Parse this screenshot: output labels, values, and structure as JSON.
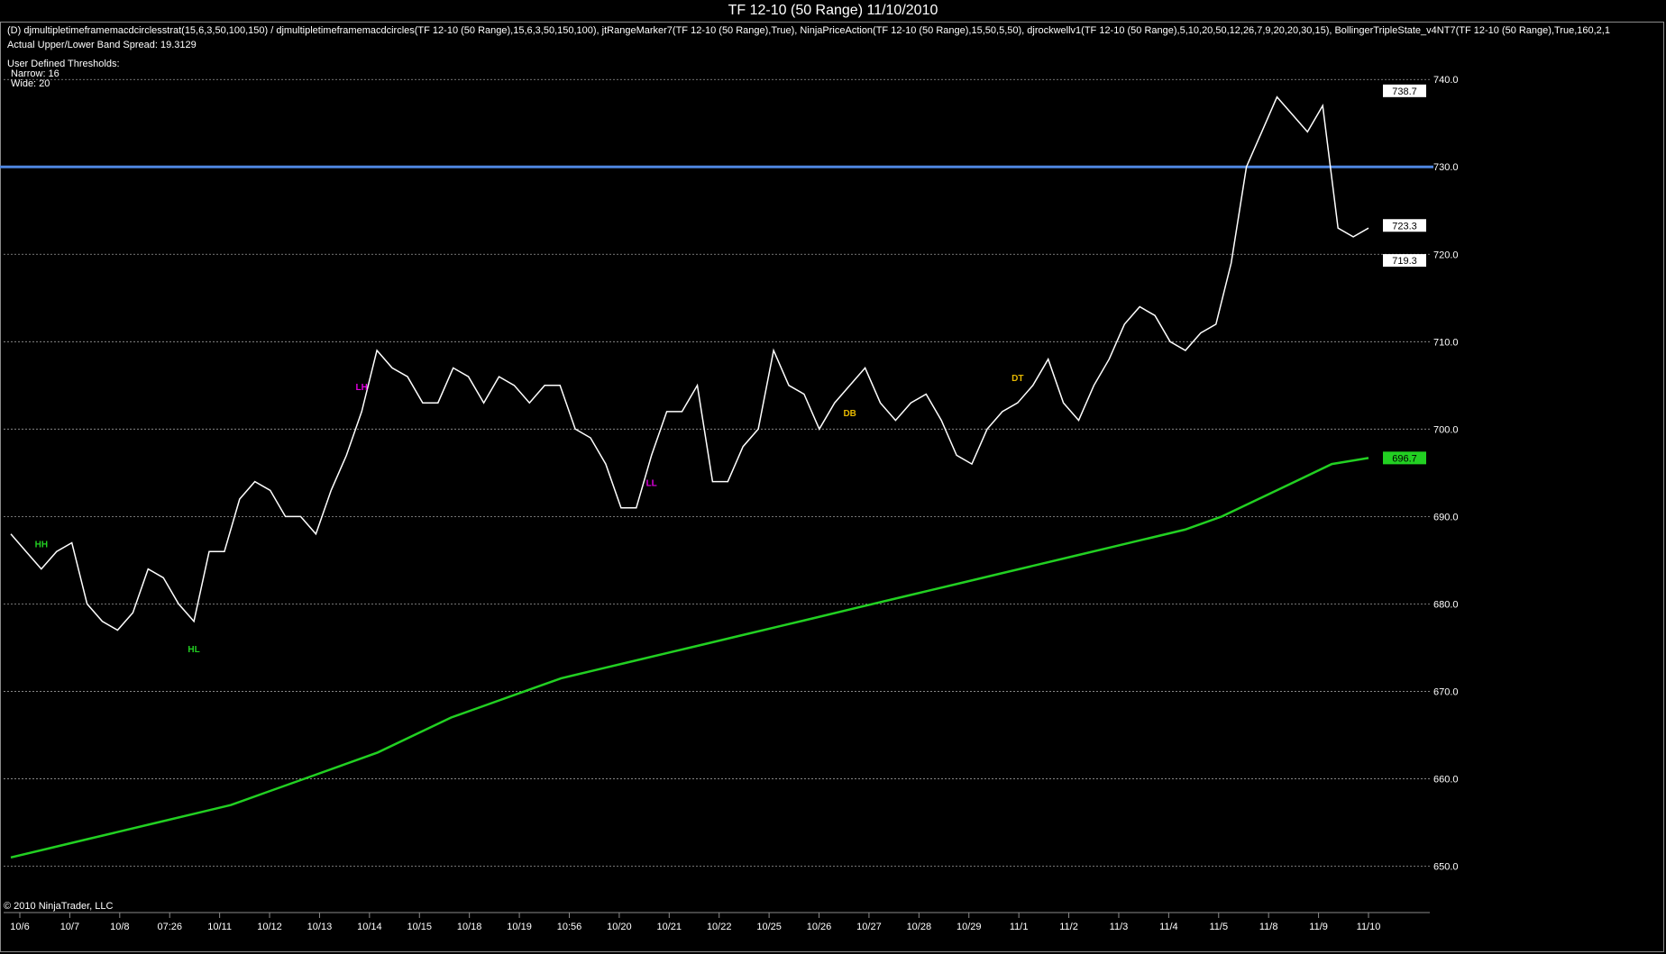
{
  "window": {
    "title": "TF 12-10 (50 Range)  11/10/2010"
  },
  "indicators_line": "(D) djmultipletimeframemacdcirclesstrat(15,6,3,50,100,150) / djmultipletimeframemacdcircles(TF 12-10 (50 Range),15,6,3,50,150,100), jtRangeMarker7(TF 12-10 (50 Range),True), NinjaPriceAction(TF 12-10 (50 Range),15,50,5,50), djrockwellv1(TF 12-10 (50 Range),5,10,20,50,12,26,7,9,20,20,30,15), BollingerTripleState_v4NT7(TF 12-10 (50 Range),True,160,2,1",
  "band_spread": "Actual Upper/Lower Band Spread: 19.3129",
  "thresholds": {
    "heading": "User Defined Thresholds:",
    "narrow": "Narrow: 16",
    "wide": "Wide: 20"
  },
  "copyright": "© 2010 NinjaTrader, LLC",
  "chart_data": {
    "type": "line",
    "ylim": [
      645,
      746
    ],
    "y_ticks": [
      650,
      660,
      670,
      680,
      690,
      700,
      710,
      720,
      730,
      740
    ],
    "y_tick_labels": [
      "650.0",
      "660.0",
      "670.0",
      "680.0",
      "690.0",
      "700.0",
      "710.0",
      "720.0",
      "730.0",
      "740.0"
    ],
    "x_labels": [
      "10/6",
      "10/7",
      "10/8",
      "07:26",
      "10/11",
      "10/12",
      "10/13",
      "10/14",
      "10/15",
      "10/18",
      "10/19",
      "10:56",
      "10/20",
      "10/21",
      "10/22",
      "10/25",
      "10/26",
      "10/27",
      "10/28",
      "10/29",
      "11/1",
      "11/2",
      "11/3",
      "11/4",
      "11/5",
      "11/8",
      "11/9",
      "11/10"
    ],
    "horizontal_line": {
      "value": 730,
      "color": "#4f86e0"
    },
    "price_badges": [
      {
        "value": 738.7,
        "label": "738.7",
        "bg": "#ffffff",
        "fg": "#000000"
      },
      {
        "value": 723.3,
        "label": "723.3",
        "bg": "#ffffff",
        "fg": "#000000"
      },
      {
        "value": 719.3,
        "label": "719.3",
        "bg": "#ffffff",
        "fg": "#000000"
      },
      {
        "value": 696.7,
        "label": "696.7",
        "bg": "#22d022",
        "fg": "#000000"
      }
    ],
    "series": [
      {
        "name": "",
        "color": "#ffffff",
        "values": [
          688,
          686,
          684,
          686,
          687,
          680,
          678,
          677,
          679,
          684,
          683,
          680,
          678,
          686,
          686,
          692,
          694,
          693,
          690,
          690,
          688,
          693,
          697,
          702,
          709,
          707,
          706,
          703,
          703,
          707,
          706,
          703,
          706,
          705,
          703,
          705,
          705,
          700,
          699,
          696,
          691,
          691,
          697,
          702,
          702,
          705,
          694,
          694,
          698,
          700,
          709,
          705,
          704,
          700,
          703,
          705,
          707,
          703,
          701,
          703,
          704,
          701,
          697,
          696,
          700,
          702,
          703,
          705,
          708,
          703,
          701,
          705,
          708,
          712,
          714,
          713,
          710,
          709,
          711,
          712,
          719,
          730,
          734,
          738,
          736,
          734,
          737,
          723,
          722,
          723
        ]
      },
      {
        "name": "",
        "color": "#22d022",
        "values": [
          651,
          652,
          653,
          654,
          655,
          656,
          657,
          658.5,
          660,
          661.5,
          663,
          665,
          667,
          668.5,
          670,
          671.5,
          672.5,
          673.5,
          674.5,
          675.5,
          676.5,
          677.5,
          678.5,
          679.5,
          680.5,
          681.5,
          682.5,
          683.5,
          684.5,
          685.5,
          686.5,
          687.5,
          688.5,
          690,
          692,
          694,
          696,
          696.7
        ]
      }
    ],
    "annotations": [
      {
        "text": "HH",
        "color": "#22d022"
      },
      {
        "text": "HL",
        "color": "#22d022"
      },
      {
        "text": "LH",
        "color": "#e000e0"
      },
      {
        "text": "LL",
        "color": "#e000e0"
      },
      {
        "text": "DB",
        "color": "#e6b800"
      },
      {
        "text": "DT",
        "color": "#e6b800"
      }
    ]
  }
}
